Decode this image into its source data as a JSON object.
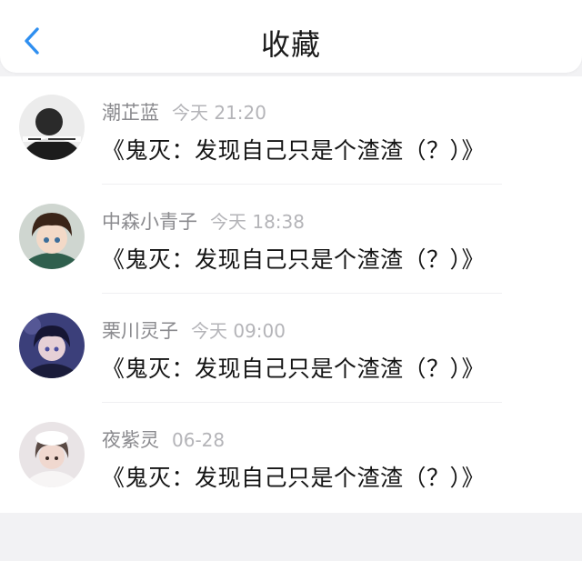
{
  "header": {
    "title": "收藏",
    "back_icon": "chevron-left-icon"
  },
  "colors": {
    "accent": "#2f8ff0",
    "background": "#f2f2f4",
    "name_text": "#8a8a8e",
    "time_text": "#b4b4b8"
  },
  "items": [
    {
      "name": "潮芷蓝",
      "time": "今天 21:20",
      "message": "《鬼灭：发现自己只是个渣渣（？）》"
    },
    {
      "name": "中森小青子",
      "time": "今天 18:38",
      "message": "《鬼灭：发现自己只是个渣渣（？）》"
    },
    {
      "name": "栗川灵子",
      "time": "今天 09:00",
      "message": "《鬼灭：发现自己只是个渣渣（？）》"
    },
    {
      "name": "夜紫灵",
      "time": "06-28",
      "message": "《鬼灭：发现自己只是个渣渣（？）》"
    }
  ]
}
